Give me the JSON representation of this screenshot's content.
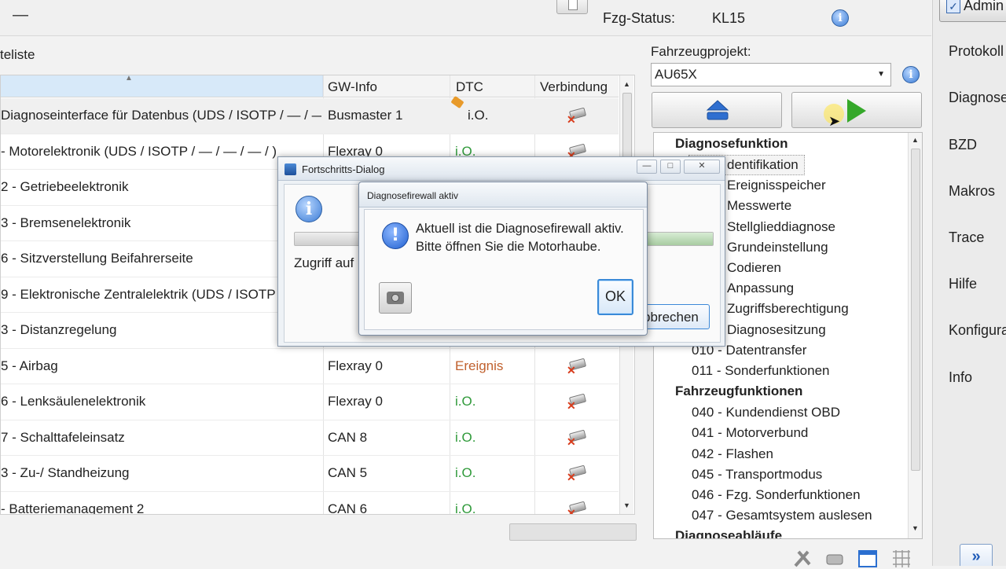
{
  "header": {
    "minus_glyph": "—",
    "fzg_status_label": "Fzg-Status:",
    "fzg_status_value": "KL15"
  },
  "right_nav": {
    "admin_label": "Admin",
    "items": [
      "Protokoll",
      "Diagnose",
      "BZD",
      "Makros",
      "Trace",
      "Hilfe",
      "Konfigurat",
      "Info"
    ],
    "expand_glyph": "»"
  },
  "device_list": {
    "title": "teliste",
    "columns": [
      "GW-Info",
      "DTC",
      "Verbindung"
    ],
    "rows": [
      {
        "name": "Diagnoseinterface für Datenbus  (UDS / ISOTP / — / —",
        "gw": "Busmaster 1",
        "dtc": "i.O."
      },
      {
        "name": " - Motorelektronik  (UDS / ISOTP / — / — / — / )",
        "gw": "Flexray 0",
        "dtc": "i.O."
      },
      {
        "name": "2 - Getriebeelektronik",
        "gw": "",
        "dtc": ""
      },
      {
        "name": "3 - Bremsenelektronik",
        "gw": "",
        "dtc": ""
      },
      {
        "name": "6 - Sitzverstellung Beifahrerseite",
        "gw": "",
        "dtc": ""
      },
      {
        "name": "9 - Elektronische Zentralelektrik  (UDS / ISOTP",
        "gw": "",
        "dtc": ""
      },
      {
        "name": "3 - Distanzregelung",
        "gw": "",
        "dtc": ""
      },
      {
        "name": "5 - Airbag",
        "gw": "Flexray 0",
        "dtc": "Ereignis"
      },
      {
        "name": "6 - Lenksäulenelektronik",
        "gw": "Flexray 0",
        "dtc": "i.O."
      },
      {
        "name": "7 - Schalttafeleinsatz",
        "gw": "CAN 8",
        "dtc": "i.O."
      },
      {
        "name": "3 - Zu-/ Standheizung",
        "gw": "CAN 5",
        "dtc": "i.O."
      },
      {
        "name": " - Batteriemanagement 2",
        "gw": "CAN 6",
        "dtc": "i.O."
      }
    ]
  },
  "project": {
    "label": "Fahrzeugprojekt:",
    "value": "AU65X"
  },
  "tree": {
    "sections": [
      {
        "title": "Diagnosefunktion",
        "items": [
          "dentifikation",
          "Ereignisspeicher",
          "Messwerte",
          "Stellglieddiagnose",
          "Grundeinstellung",
          "Codieren",
          "Anpassung",
          "Zugriffsberechtigung",
          "Diagnosesitzung",
          "010 - Datentransfer",
          "011 - Sonderfunktionen"
        ]
      },
      {
        "title": "Fahrzeugfunktionen",
        "items": [
          "040 - Kundendienst OBD",
          "041 - Motorverbund",
          "042 - Flashen",
          "045 - Transportmodus",
          "046 - Fzg. Sonderfunktionen",
          "047 - Gesamtsystem auslesen"
        ]
      },
      {
        "title": "Diagnoseabläufe",
        "items": []
      }
    ]
  },
  "progress_dialog": {
    "title": "Fortschritts-Dialog",
    "info_glyph": "i",
    "status_text": "Zugriff auf",
    "cancel_label": "bbrechen",
    "progress_fraction": 0.2
  },
  "firewall_dialog": {
    "title": "Diagnosefirewall aktiv",
    "icon_glyph": "!",
    "message_line1": "Aktuell ist die Diagnosefirewall aktiv.",
    "message_line2": "Bitte öffnen Sie die Motorhaube.",
    "ok_label": "OK"
  },
  "colors": {
    "ok_green": "#2f9a3a",
    "event_orange": "#c0602d",
    "play_green": "#35a82a",
    "selection_blue": "#d7e9f9"
  }
}
